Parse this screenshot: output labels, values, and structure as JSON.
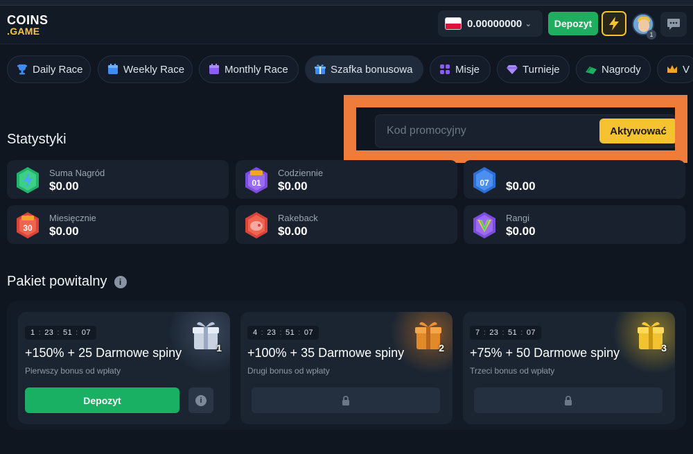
{
  "header": {
    "logo_line1": "COINS",
    "logo_line2": ".GAME",
    "balance": "0.00000000",
    "deposit_label": "Depozyt",
    "avatar_badge": "1"
  },
  "tabs": [
    {
      "label": "Daily Race",
      "icon": "trophy-icon"
    },
    {
      "label": "Weekly Race",
      "icon": "calendar-icon"
    },
    {
      "label": "Monthly Race",
      "icon": "calendar-month-icon"
    },
    {
      "label": "Szafka bonusowa",
      "icon": "gift-icon",
      "active": true
    },
    {
      "label": "Misje",
      "icon": "grid-icon"
    },
    {
      "label": "Turnieje",
      "icon": "diamond-icon"
    },
    {
      "label": "Nagrody",
      "icon": "cash-icon"
    },
    {
      "label": "V",
      "icon": "crown-icon"
    }
  ],
  "promo": {
    "placeholder": "Kod promocyjny",
    "activate_label": "Aktywować"
  },
  "stats": {
    "title": "Statystyki",
    "items": [
      {
        "label": "Suma Nagród",
        "value": "$0.00",
        "icon": "lightning-badge-icon"
      },
      {
        "label": "Codziennie",
        "value": "$0.00",
        "icon": "day-01-badge-icon",
        "badge": "01"
      },
      {
        "label": "",
        "value": "$0.00",
        "icon": "week-07-badge-icon",
        "badge": "07"
      },
      {
        "label": "Miesięcznie",
        "value": "$0.00",
        "icon": "month-30-badge-icon",
        "badge": "30"
      },
      {
        "label": "Rakeback",
        "value": "$0.00",
        "icon": "piggy-badge-icon"
      },
      {
        "label": "Rangi",
        "value": "$0.00",
        "icon": "rank-badge-icon"
      }
    ]
  },
  "welcome": {
    "title": "Pakiet powitalny",
    "cards": [
      {
        "timer": [
          "1",
          "23",
          "51",
          "07"
        ],
        "title": "+150% + 25 Darmowe spiny",
        "subtitle": "Pierwszy bonus od wpłaty",
        "button": "Depozyt",
        "locked": false,
        "gift_number": "1"
      },
      {
        "timer": [
          "4",
          "23",
          "51",
          "07"
        ],
        "title": "+100% + 35 Darmowe spiny",
        "subtitle": "Drugi bonus od wpłaty",
        "locked": true,
        "gift_number": "2"
      },
      {
        "timer": [
          "7",
          "23",
          "51",
          "07"
        ],
        "title": "+75% + 50 Darmowe spiny",
        "subtitle": "Trzeci bonus od wpłaty",
        "locked": true,
        "gift_number": "3"
      }
    ]
  },
  "colors": {
    "background": "#0f1620",
    "card": "#18212d",
    "green": "#1fae5f",
    "yellow": "#f5c330",
    "highlight": "#f07c3c"
  }
}
